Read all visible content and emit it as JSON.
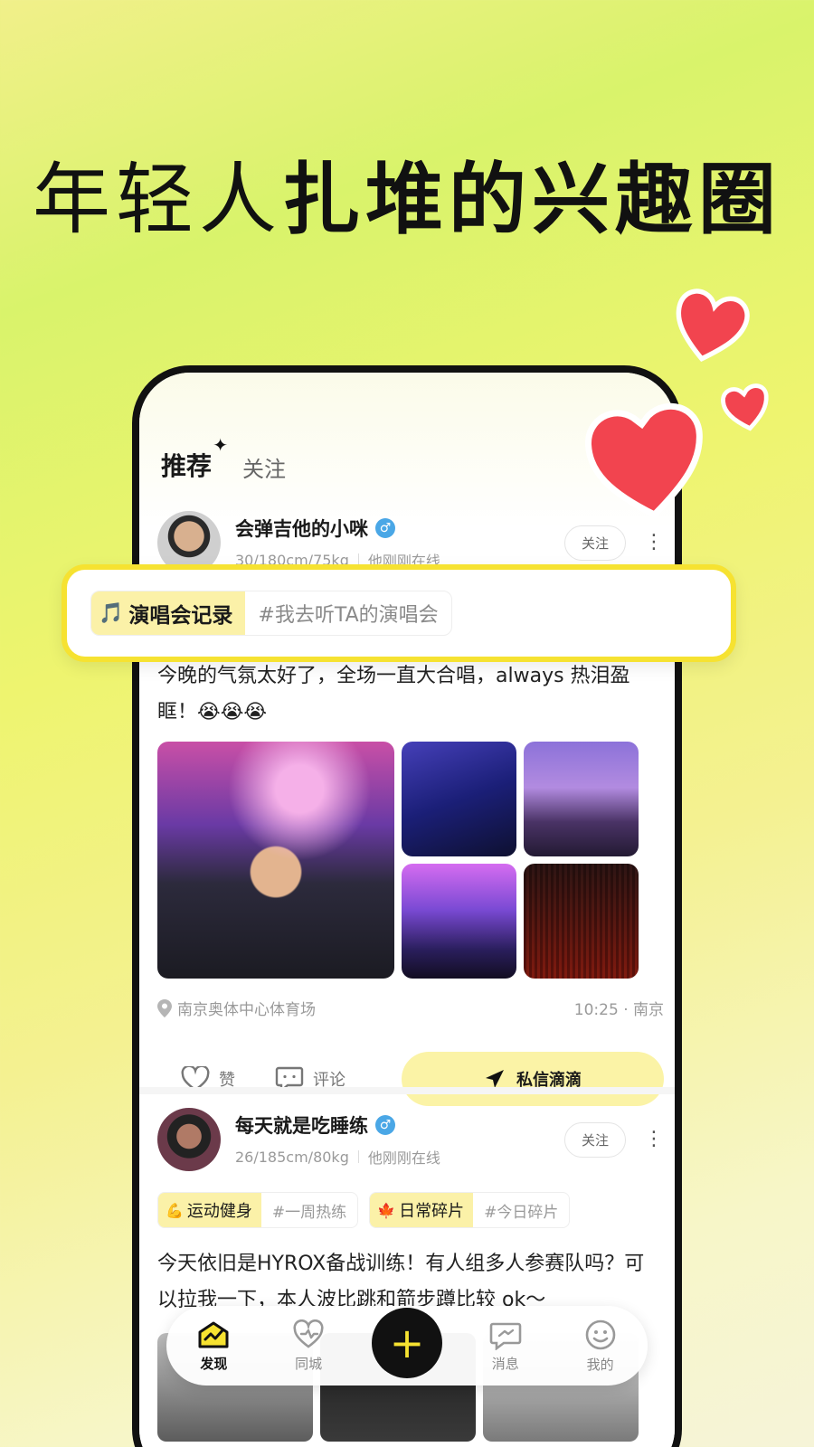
{
  "headline": {
    "light": "年轻人",
    "bold": "扎堆的兴趣圈"
  },
  "feed_tabs": {
    "recommend": "推荐",
    "following": "关注",
    "spark": "✦"
  },
  "post1": {
    "username": "会弹吉他的小咪",
    "gender_icon": "♂",
    "stats": "30/180cm/75kg",
    "online": "他刚刚在线",
    "follow_label": "关注",
    "topic_emoji": "🎵",
    "topic_name": "演唱会记录",
    "topic_tag": "#我去听TA的演唱会",
    "text": "今晚的气氛太好了，全场一直大合唱，always 热泪盈眶！😭😭😭",
    "location": "南京奥体中心体育场",
    "time_city": "10:25 · 南京",
    "like_label": "赞",
    "comment_label": "评论",
    "dm_label": "私信滴滴"
  },
  "post2": {
    "username": "每天就是吃睡练",
    "gender_icon": "♂",
    "stats": "26/185cm/80kg",
    "online": "他刚刚在线",
    "follow_label": "关注",
    "chips": [
      {
        "emoji": "💪",
        "name": "运动健身",
        "tag": "#一周热练"
      },
      {
        "emoji": "🍁",
        "name": "日常碎片",
        "tag": "#今日碎片"
      }
    ],
    "text": "今天依旧是HYROX备战训练！有人组多人参赛队吗？可以拉我一下，本人波比跳和箭步蹲比较 ok～"
  },
  "tabbar": {
    "discover": "发现",
    "nearby": "同城",
    "plus": "+",
    "messages": "消息",
    "me": "我的"
  },
  "colors": {
    "accent_yellow": "#f6e231",
    "chip_yellow": "#fbf1a8",
    "heart_red": "#f2444f"
  }
}
